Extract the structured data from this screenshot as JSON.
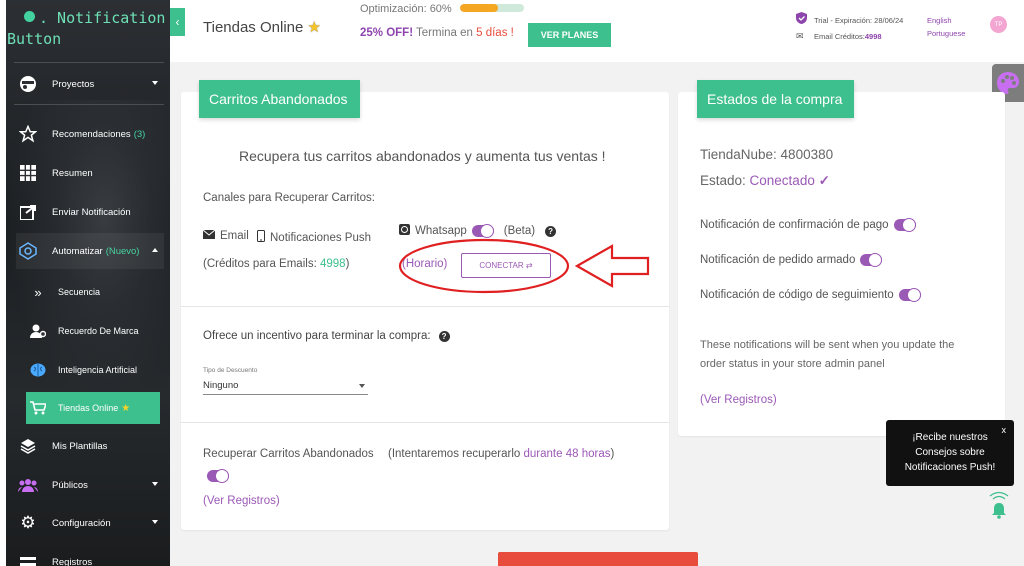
{
  "app": {
    "logo_line1": ". Notification",
    "logo_line2": "Button"
  },
  "sidebar": {
    "items": [
      {
        "label": "Proyectos",
        "icon": "projects-icon"
      },
      {
        "label": "Recomendaciones",
        "count": "(3)",
        "icon": "star-icon"
      },
      {
        "label": "Resumen",
        "icon": "grid-icon"
      },
      {
        "label": "Enviar Notificación",
        "icon": "share-icon"
      },
      {
        "label": "Automatizar",
        "badge": "(Nuevo)",
        "icon": "automation-icon"
      },
      {
        "label": "Secuencia",
        "icon": "double-chevron-icon"
      },
      {
        "label": "Recuerdo De Marca",
        "icon": "user-gear-icon"
      },
      {
        "label": "Inteligencia Artificial",
        "icon": "brain-icon"
      },
      {
        "label": "Tiendas Online",
        "icon": "cart-icon"
      },
      {
        "label": "Mis Plantillas",
        "icon": "layers-icon"
      },
      {
        "label": "Públicos",
        "icon": "users-icon"
      },
      {
        "label": "Configuración",
        "icon": "gear-icon"
      },
      {
        "label": "Registros",
        "icon": "list-icon"
      }
    ]
  },
  "topbar": {
    "collapse_glyph": "‹",
    "store_title": "Tiendas Online",
    "optim_label": "Optimización: 60%",
    "optim_progress": 0.6,
    "offer_pct": "25% OFF!",
    "offer_text": " Termina en ",
    "offer_days": "5 días",
    "offer_bang": " !",
    "plans_button": "VER PLANES",
    "trial_text": "Trial - Expiración: 28/06/24",
    "email_credits_label": "Email Créditos: ",
    "email_credits_value": "4998",
    "lang_en": "English",
    "lang_pt": "Portuguese",
    "avatar_initials": "TP"
  },
  "carritos": {
    "tab": "Carritos Abandonados",
    "heading": "Recupera tus carritos abandonados y aumenta tus ventas !",
    "channels_label": "Canales para Recuperar Carritos:",
    "email_label": "Email",
    "push_label": "Notificaciones Push",
    "whatsapp_label": "Whatsapp",
    "beta_label": "(Beta)",
    "credits_prefix": "(Créditos para Emails: ",
    "credits_value": "4998",
    "credits_suffix": ")",
    "horario": "(Horario)",
    "connect_button": "CONECTAR ⇄",
    "incentive_label": "Ofrece un incentivo para terminar la compra:",
    "discount_type_label": "Tipo de Descuento",
    "discount_type_value": "Ninguno",
    "recover_label": "Recuperar Carritos Abandonados",
    "recover_hint_prefix": "(Intentaremos recuperarlo ",
    "recover_hint_link": "durante 48 horas",
    "recover_hint_suffix": ")",
    "ver_registros": "(Ver Registros)"
  },
  "estados": {
    "tab": "Estados de la compra",
    "tiendanube": "TiendaNube: 4800380",
    "estado_label": "Estado: ",
    "estado_value": "Conectado",
    "check_glyph": "✓",
    "notif_pago": "Notificación de confirmación de pago",
    "notif_armado": "Notificación de pedido armado",
    "notif_seguimiento": "Notificación de código de seguimiento",
    "note": "These notifications will be sent when you update the order status in your store admin panel",
    "ver_registros": "(Ver Registros)"
  },
  "tooltip": {
    "close": "x",
    "line1": "¡Recibe nuestros",
    "line2": "Consejos sobre",
    "line3": "Notificaciones Push!"
  },
  "colors": {
    "accent": "#3dbf8e",
    "purple": "#9b59b6",
    "annotation_red": "#e02020"
  }
}
